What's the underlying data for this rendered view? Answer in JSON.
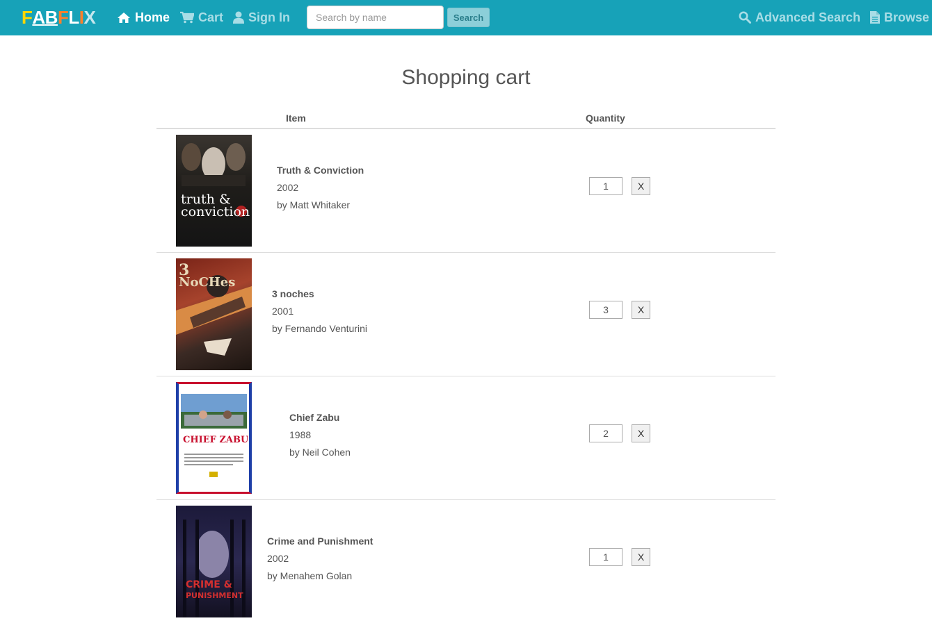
{
  "nav": {
    "logo": {
      "part1": "F",
      "part2": "A",
      "part3": "B",
      "part4": "F",
      "part5": "L",
      "part6": "I",
      "part7": "X"
    },
    "home": "Home",
    "cart": "Cart",
    "sign_in": "Sign In",
    "search_placeholder": "Search by name",
    "search_button": "Search",
    "advanced_search": "Advanced Search",
    "browse": "Browse",
    "icons": {
      "home": "home-icon",
      "cart": "cart-icon",
      "user": "user-icon",
      "search": "search-icon",
      "browse": "document-icon"
    }
  },
  "page": {
    "title": "Shopping cart",
    "col_item": "Item",
    "col_quantity": "Quantity"
  },
  "cart": [
    {
      "title": "Truth & Conviction",
      "year": "2002",
      "director": "by Matt Whitaker",
      "quantity": "1",
      "remove": "X",
      "poster_title_1": "truth &",
      "poster_title_2": "conviction"
    },
    {
      "title": "3 noches",
      "year": "2001",
      "director": "by Fernando Venturini",
      "quantity": "3",
      "remove": "X",
      "poster_title_1": "3",
      "poster_title_2": "NoCHes"
    },
    {
      "title": "Chief Zabu",
      "year": "1988",
      "director": "by Neil Cohen",
      "quantity": "2",
      "remove": "X",
      "poster_title_1": "CHIEF ZABU"
    },
    {
      "title": "Crime and Punishment",
      "year": "2002",
      "director": "by Menahem Golan",
      "quantity": "1",
      "remove": "X",
      "poster_title_1": "CRIME &",
      "poster_title_2": "PUNISHMENT"
    }
  ],
  "colors": {
    "navbar": "#17a2b8",
    "logo_yellow": "#ffd700",
    "logo_orange": "#ff7f2a"
  }
}
